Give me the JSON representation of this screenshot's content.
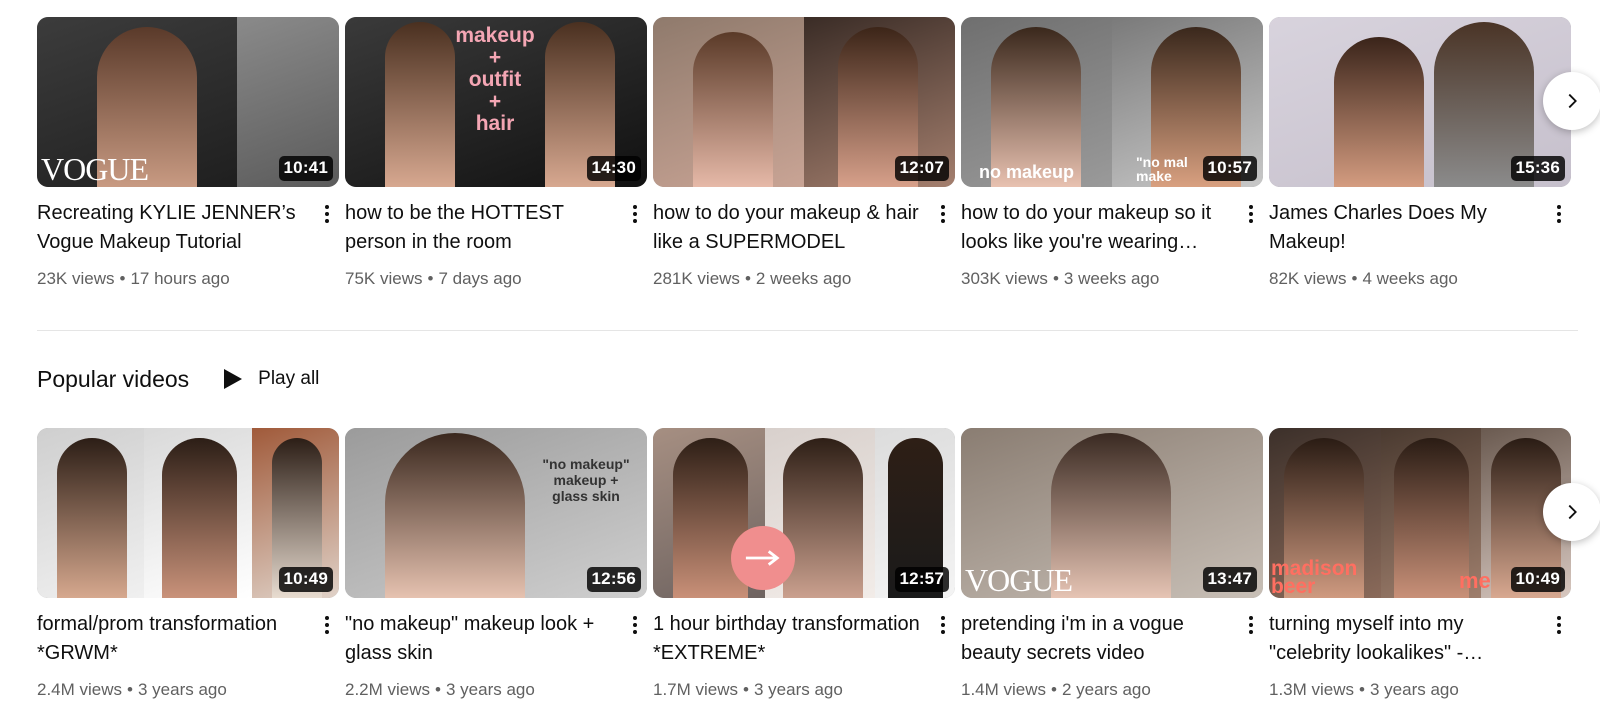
{
  "recent_shelf": {
    "videos": [
      {
        "title": "Recreating KYLIE JENNER’s Vogue Makeup Tutorial",
        "duration": "10:41",
        "views": "23K views",
        "age": "17 hours ago",
        "overlay": "VOGUE"
      },
      {
        "title": "how to be the HOTTEST person in the room",
        "duration": "14:30",
        "views": "75K views",
        "age": "7 days ago",
        "overlay": "makeup\n+\noutfit\n+\nhair"
      },
      {
        "title": "how to do your makeup & hair like a SUPERMODEL",
        "duration": "12:07",
        "views": "281K views",
        "age": "2 weeks ago"
      },
      {
        "title": "how to do your makeup so it looks like you're wearing…",
        "duration": "10:57",
        "views": "303K views",
        "age": "3 weeks ago",
        "overlay_left": "no makeup",
        "overlay_right": "\"no mal\nmake"
      },
      {
        "title": "James Charles Does My Makeup!",
        "duration": "15:36",
        "views": "82K views",
        "age": "4 weeks ago"
      }
    ],
    "next_icon": "chevron-right-icon"
  },
  "popular_section": {
    "title": "Popular videos",
    "play_all_label": "Play all",
    "play_icon": "play-icon",
    "videos": [
      {
        "title": "formal/prom transformation *GRWM*",
        "duration": "10:49",
        "views": "2.4M views",
        "age": "3 years ago"
      },
      {
        "title": "\"no makeup\" makeup look + glass skin",
        "duration": "12:56",
        "views": "2.2M views",
        "age": "3 years ago",
        "overlay": "\"no makeup\"\nmakeup +\nglass skin"
      },
      {
        "title": "1 hour birthday transformation *EXTREME*",
        "duration": "12:57",
        "views": "1.7M views",
        "age": "3 years ago"
      },
      {
        "title": "pretending i'm in a vogue beauty secrets video",
        "duration": "13:47",
        "views": "1.4M views",
        "age": "2 years ago",
        "overlay": "VOGUE"
      },
      {
        "title": "turning myself into my \"celebrity lookalikes\" -…",
        "duration": "10:49",
        "views": "1.3M views",
        "age": "3 years ago",
        "overlay_left": "madison\nbeer",
        "overlay_right": "me"
      }
    ],
    "next_icon": "chevron-right-icon"
  },
  "colors": {
    "text_primary": "#0f0f0f",
    "text_secondary": "#606060",
    "overlay_pink": "#f4a6b4",
    "overlay_coral": "#ff6f61",
    "divider": "#e5e5e5"
  }
}
